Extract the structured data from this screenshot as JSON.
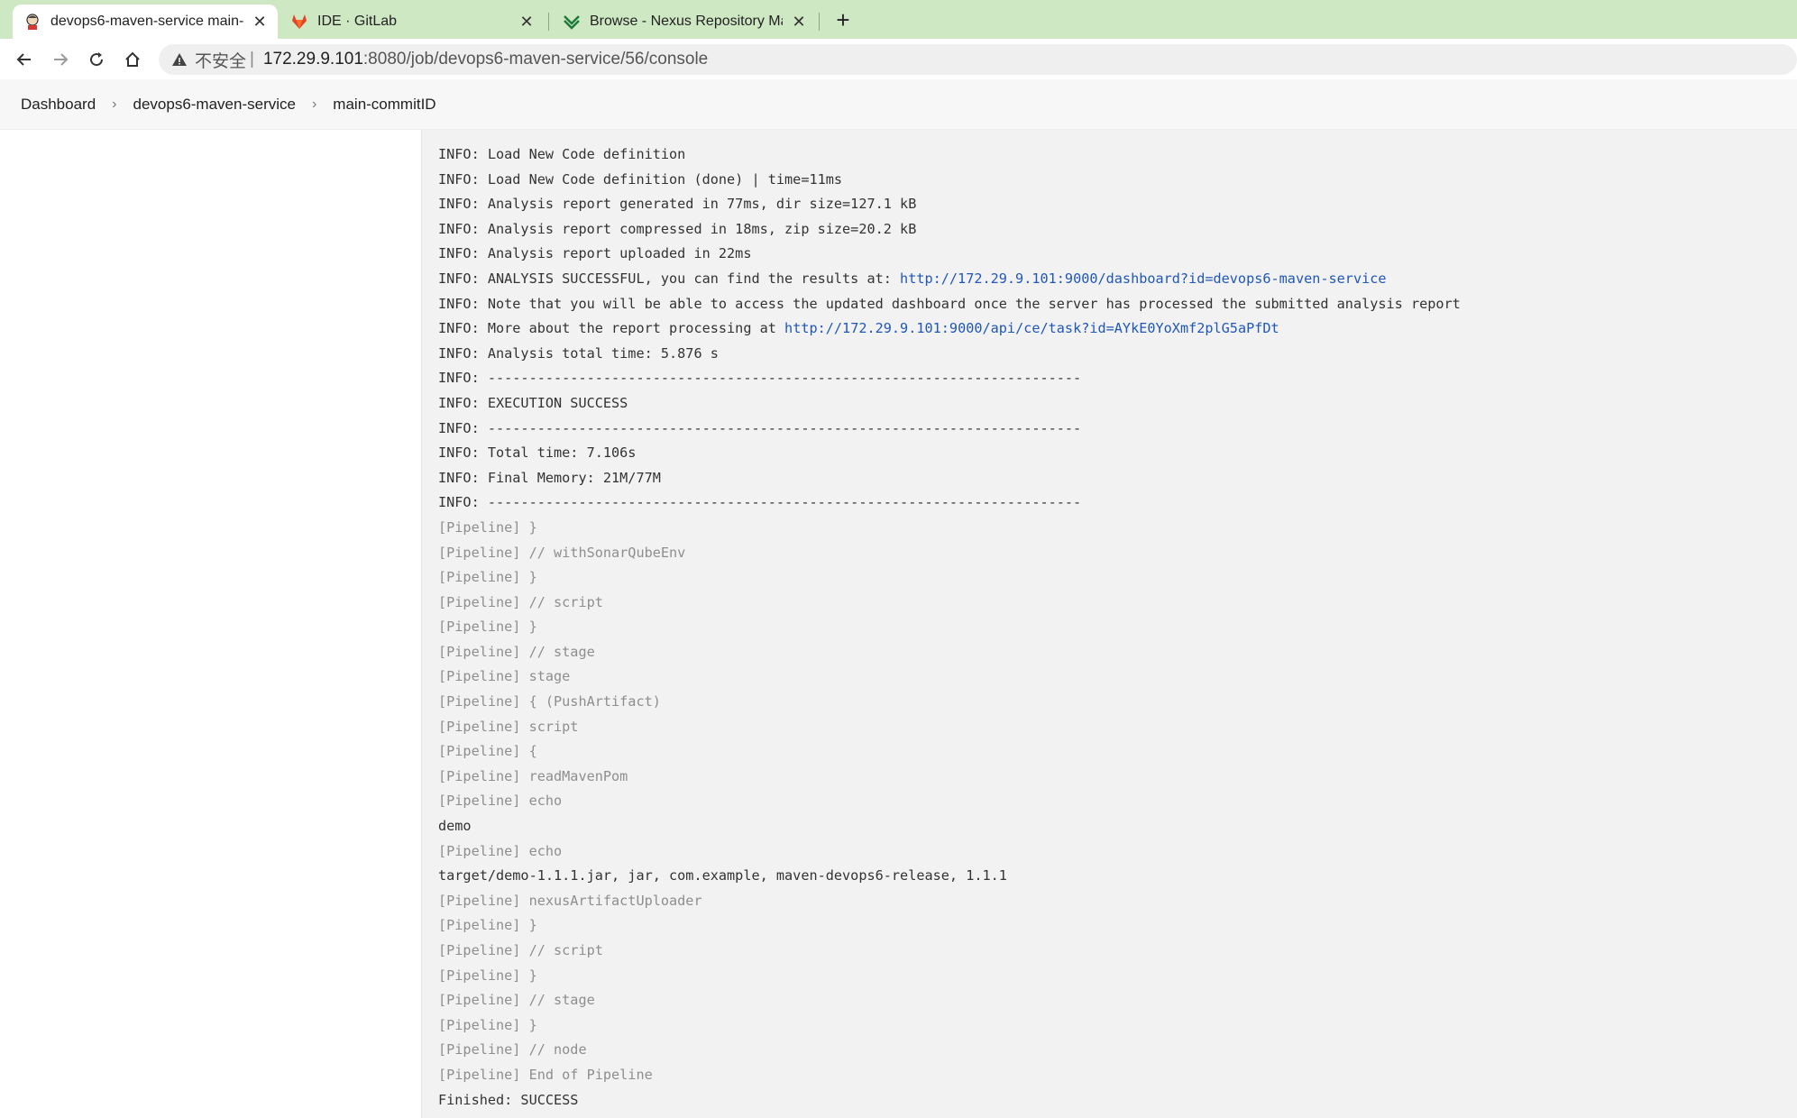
{
  "browser": {
    "tabs": [
      {
        "title": "devops6-maven-service main-",
        "icon": "jenkins-icon",
        "active": true
      },
      {
        "title": "IDE · GitLab",
        "icon": "gitlab-icon",
        "active": false
      },
      {
        "title": "Browse - Nexus Repository Ma",
        "icon": "nexus-icon",
        "active": false
      }
    ],
    "new_tab_label": "+",
    "close_label": "✕",
    "address": {
      "security_label": "不安全",
      "separator": "|",
      "host": "172.29.9.101",
      "path": ":8080/job/devops6-maven-service/56/console"
    }
  },
  "breadcrumb": {
    "items": [
      "Dashboard",
      "devops6-maven-service",
      "main-commitID"
    ],
    "separator": "›"
  },
  "console": {
    "lines": [
      {
        "text": "INFO: Load New Code definition",
        "kind": "info"
      },
      {
        "text": "INFO: Load New Code definition (done) | time=11ms",
        "kind": "info"
      },
      {
        "text": "INFO: Analysis report generated in 77ms, dir size=127.1 kB",
        "kind": "info"
      },
      {
        "text": "INFO: Analysis report compressed in 18ms, zip size=20.2 kB",
        "kind": "info"
      },
      {
        "text": "INFO: Analysis report uploaded in 22ms",
        "kind": "info"
      },
      {
        "text": "INFO: ANALYSIS SUCCESSFUL, you can find the results at: ",
        "link": "http://172.29.9.101:9000/dashboard?id=devops6-maven-service",
        "kind": "info"
      },
      {
        "text": "INFO: Note that you will be able to access the updated dashboard once the server has processed the submitted analysis report",
        "kind": "info"
      },
      {
        "text": "INFO: More about the report processing at ",
        "link": "http://172.29.9.101:9000/api/ce/task?id=AYkE0YoXmf2plG5aPfDt",
        "kind": "info"
      },
      {
        "text": "INFO: Analysis total time: 5.876 s",
        "kind": "info"
      },
      {
        "text": "INFO: ------------------------------------------------------------------------",
        "kind": "info"
      },
      {
        "text": "INFO: EXECUTION SUCCESS",
        "kind": "info"
      },
      {
        "text": "INFO: ------------------------------------------------------------------------",
        "kind": "info"
      },
      {
        "text": "INFO: Total time: 7.106s",
        "kind": "info"
      },
      {
        "text": "INFO: Final Memory: 21M/77M",
        "kind": "info"
      },
      {
        "text": "INFO: ------------------------------------------------------------------------",
        "kind": "info"
      },
      {
        "text": "[Pipeline] }",
        "kind": "pipeline"
      },
      {
        "text": "[Pipeline] // withSonarQubeEnv",
        "kind": "pipeline"
      },
      {
        "text": "[Pipeline] }",
        "kind": "pipeline"
      },
      {
        "text": "[Pipeline] // script",
        "kind": "pipeline"
      },
      {
        "text": "[Pipeline] }",
        "kind": "pipeline"
      },
      {
        "text": "[Pipeline] // stage",
        "kind": "pipeline"
      },
      {
        "text": "[Pipeline] stage",
        "kind": "pipeline"
      },
      {
        "text": "[Pipeline] { (PushArtifact)",
        "kind": "pipeline"
      },
      {
        "text": "[Pipeline] script",
        "kind": "pipeline"
      },
      {
        "text": "[Pipeline] {",
        "kind": "pipeline"
      },
      {
        "text": "[Pipeline] readMavenPom",
        "kind": "pipeline"
      },
      {
        "text": "[Pipeline] echo",
        "kind": "pipeline"
      },
      {
        "text": "demo",
        "kind": "output"
      },
      {
        "text": "[Pipeline] echo",
        "kind": "pipeline"
      },
      {
        "text": "target/demo-1.1.1.jar, jar, com.example, maven-devops6-release, 1.1.1",
        "kind": "output"
      },
      {
        "text": "[Pipeline] nexusArtifactUploader",
        "kind": "pipeline"
      },
      {
        "text": "[Pipeline] }",
        "kind": "pipeline"
      },
      {
        "text": "[Pipeline] // script",
        "kind": "pipeline"
      },
      {
        "text": "[Pipeline] }",
        "kind": "pipeline"
      },
      {
        "text": "[Pipeline] // stage",
        "kind": "pipeline"
      },
      {
        "text": "[Pipeline] }",
        "kind": "pipeline"
      },
      {
        "text": "[Pipeline] // node",
        "kind": "pipeline"
      },
      {
        "text": "[Pipeline] End of Pipeline",
        "kind": "pipeline"
      },
      {
        "text": "Finished: SUCCESS",
        "kind": "output"
      }
    ]
  },
  "colors": {
    "tabstrip": "#cfe8c4",
    "console_bg": "#f2f2f2",
    "pipeline_text": "#8e8e8e",
    "link": "#2057b8"
  }
}
